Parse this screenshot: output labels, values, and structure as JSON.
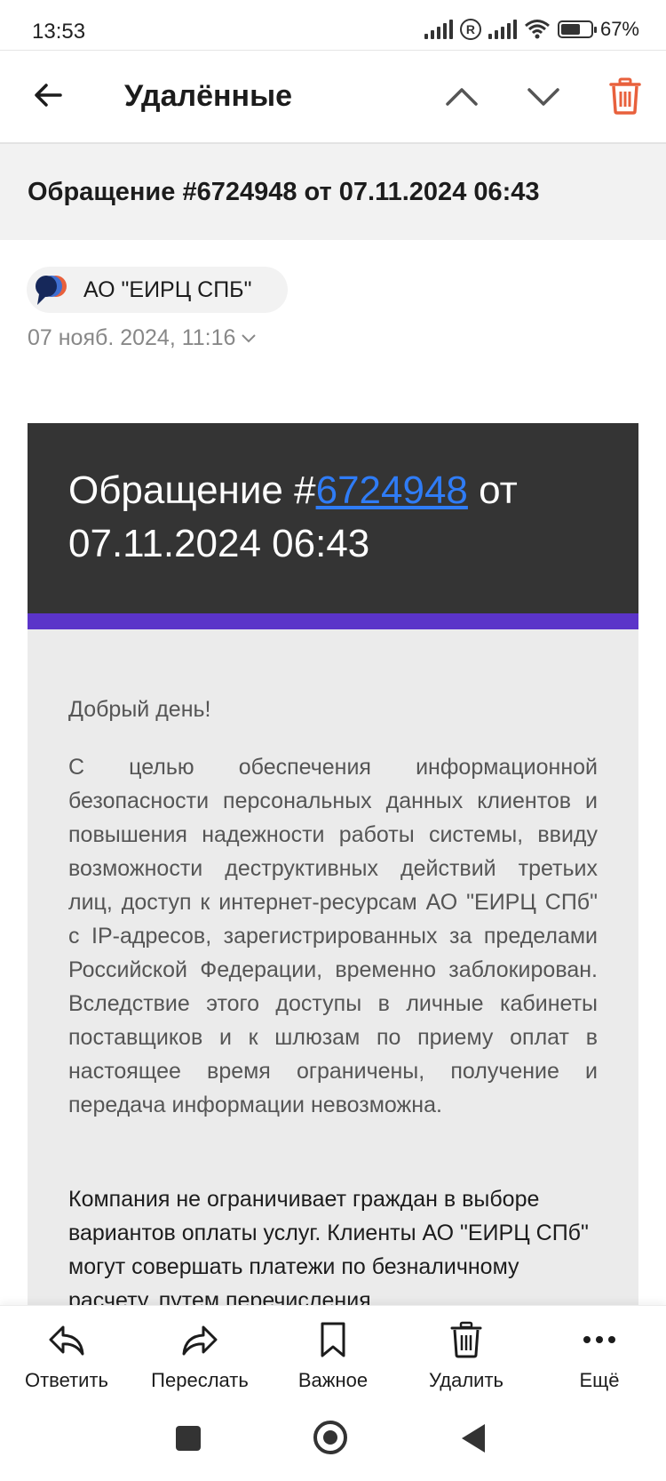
{
  "status_bar": {
    "time": "13:53",
    "battery_percent": "67%",
    "battery_level": 0.67,
    "icons": [
      "cellular-signal-icon",
      "roaming-icon",
      "cellular-signal-icon",
      "wifi-icon",
      "battery-icon"
    ]
  },
  "header": {
    "title": "Удалённые",
    "icons": [
      "back-arrow-icon",
      "chevron-up-icon",
      "chevron-down-icon",
      "trash-icon"
    ],
    "accent_color": "#e8603c"
  },
  "subject": "Обращение #6724948 от 07.11.2024 06:43",
  "sender": {
    "name": "АО \"ЕИРЦ СПБ\"",
    "date": "07 нояб. 2024, 11:16"
  },
  "email": {
    "title_prefix": "Обращение #",
    "title_link": "6724948",
    "title_suffix": " от 07.11.2024 06:43",
    "header_bg": "#343434",
    "strip_color": "#5b34c9",
    "link_color": "#2f7cf6",
    "greeting": "Добрый день!",
    "paragraph1": "С целью обеспечения информационной безопасности персональных данных клиентов и повышения надежности работы системы, ввиду возможности деструктивных действий третьих лиц, доступ к интернет-ресурсам АО \"ЕИРЦ СПб\" с IP-адресов, зарегистрированных за пределами Российской Федерации, временно заблокирован. Вследствие этого доступы в личные кабинеты поставщиков и к шлюзам по приему оплат в настоящее время ограничены, получение и передача информации невозможна.",
    "paragraph2": "Компания не ограничивает граждан в выборе вариантов оплаты услуг. Клиенты АО \"ЕИРЦ СПб\" могут совершать платежи по безналичному расчету, путем перечисления"
  },
  "toolbar": {
    "reply": "Ответить",
    "forward": "Переслать",
    "important": "Важное",
    "delete": "Удалить",
    "more": "Ещё"
  },
  "system_nav": {
    "icons": [
      "recent-apps-icon",
      "home-icon",
      "back-icon"
    ]
  }
}
